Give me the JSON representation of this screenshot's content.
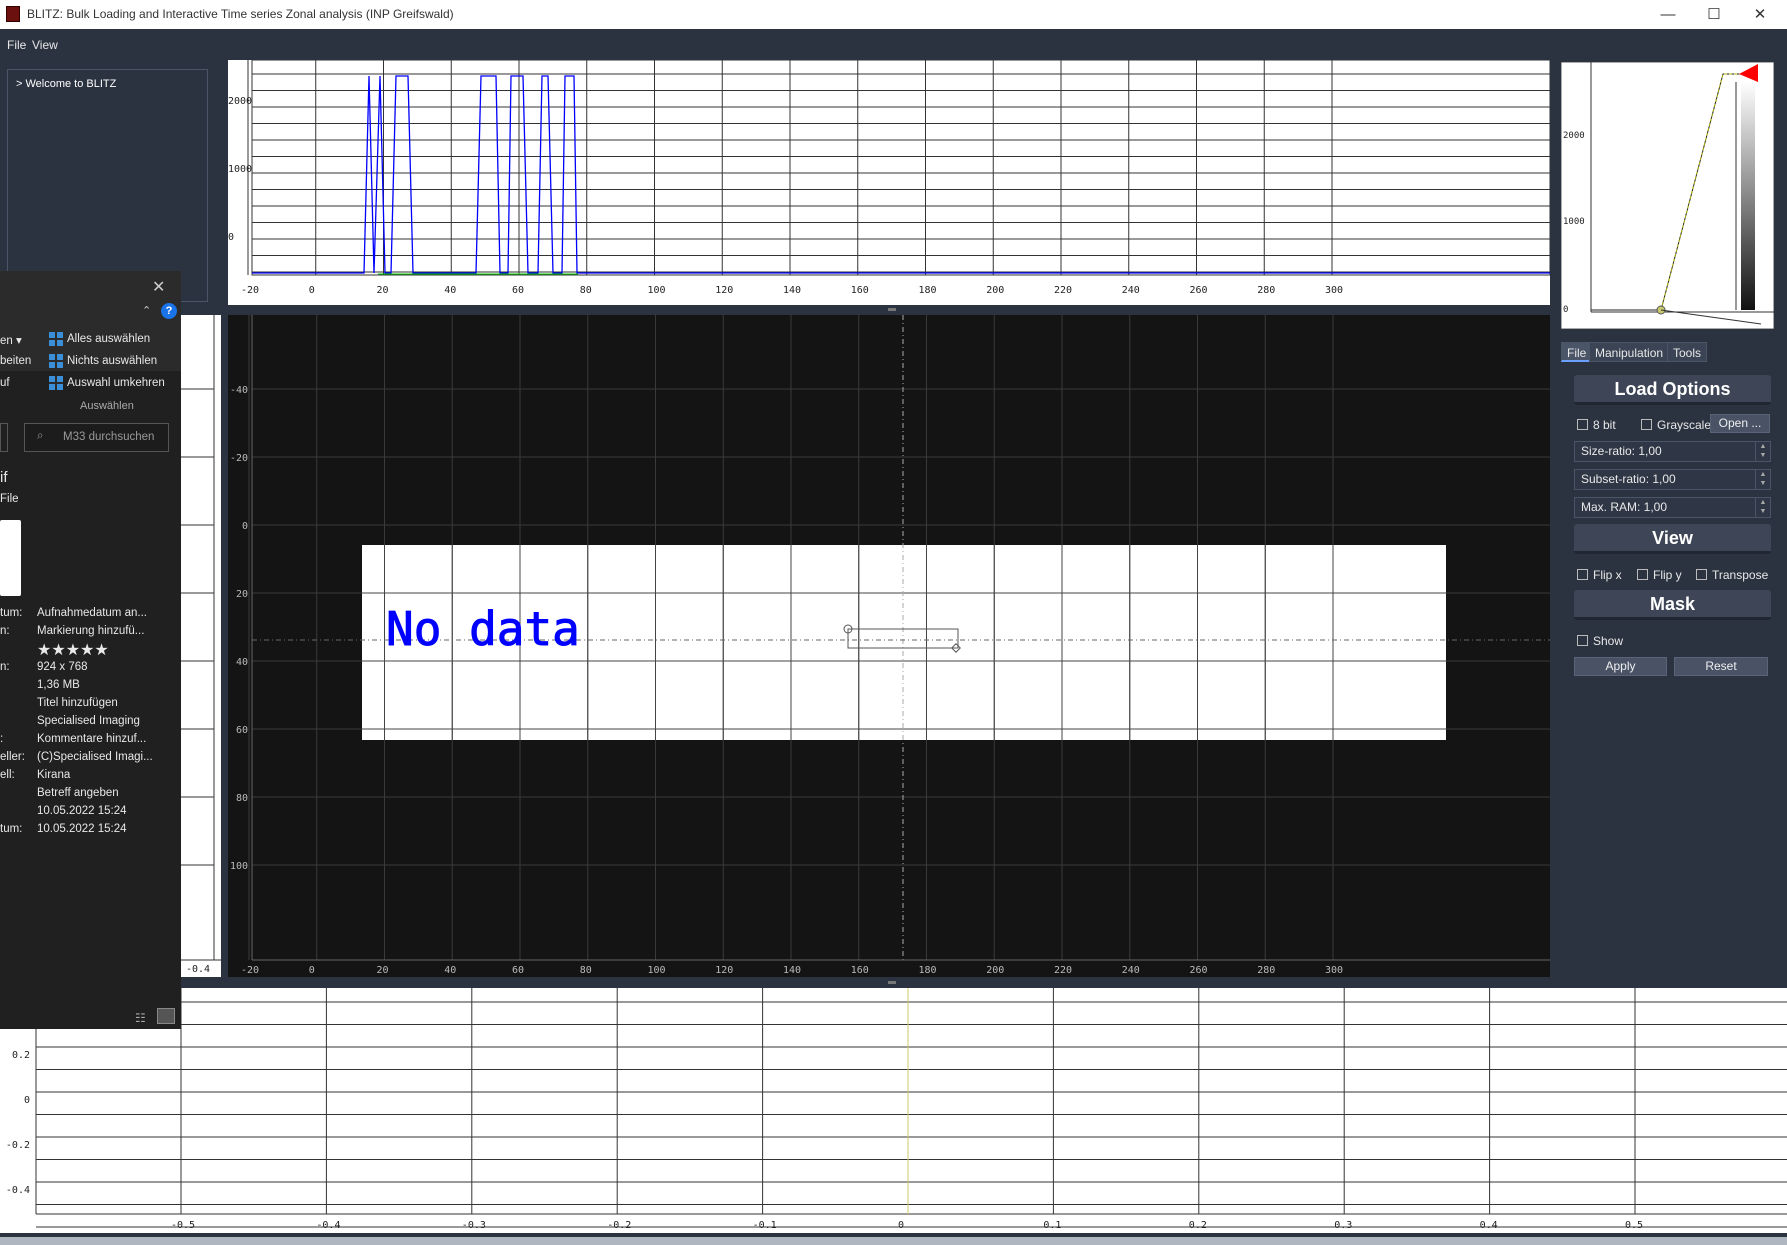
{
  "window": {
    "title": "BLITZ: Bulk Loading and Interactive Time series Zonal analysis (INP Greifswald)",
    "minimize": "—",
    "maximize": "☐",
    "close": "✕"
  },
  "menu": {
    "file": "File",
    "view": "View"
  },
  "log": {
    "text": "> Welcome to BLITZ"
  },
  "timeline_plot": {
    "x_ticks": [
      "-20",
      "0",
      "20",
      "40",
      "60",
      "80",
      "100",
      "120",
      "140",
      "160",
      "180",
      "200",
      "220",
      "240",
      "260",
      "280",
      "300"
    ],
    "y_ticks": [
      "2000",
      "1000",
      "0"
    ]
  },
  "main_image": {
    "no_data_text": "No data",
    "x_ticks": [
      "-20",
      "0",
      "20",
      "40",
      "60",
      "80",
      "100",
      "120",
      "140",
      "160",
      "180",
      "200",
      "220",
      "240",
      "260",
      "280",
      "300"
    ],
    "y_ticks": [
      "-40",
      "-20",
      "0",
      "20",
      "40",
      "60",
      "80",
      "100"
    ],
    "left_tick": "-0.4"
  },
  "histogram": {
    "y_ticks": [
      "2000",
      "1000",
      "0"
    ]
  },
  "bottom_plot": {
    "x_ticks": [
      "-0.5",
      "-0.4",
      "-0.3",
      "-0.2",
      "-0.1",
      "0",
      "0.1",
      "0.2",
      "0.3",
      "0.4",
      "0.5"
    ],
    "y_ticks": [
      "0.2",
      "0",
      "-0.2",
      "-0.4"
    ]
  },
  "explorer": {
    "menu_open": "en ▾",
    "menu_edit": "beiten",
    "menu_run": "uf",
    "select_all": "Alles auswählen",
    "select_none": "Nichts auswählen",
    "invert_selection": "Auswahl umkehren",
    "group_label": "Auswählen",
    "search_placeholder": "M33 durchsuchen",
    "file_ext": "if",
    "file_type": "File",
    "props": [
      {
        "k": "tum:",
        "v": "Aufnahmedatum an..."
      },
      {
        "k": "n:",
        "v": "Markierung hinzufü..."
      },
      {
        "k": "",
        "v": "★★★★★"
      },
      {
        "k": "n:",
        "v": "924 x 768"
      },
      {
        "k": "",
        "v": "1,36 MB"
      },
      {
        "k": "",
        "v": "Titel hinzufügen"
      },
      {
        "k": "",
        "v": "Specialised Imaging"
      },
      {
        "k": ":",
        "v": "Kommentare hinzuf..."
      },
      {
        "k": "eller:",
        "v": "(C)Specialised Imagi..."
      },
      {
        "k": "ell:",
        "v": "Kirana"
      },
      {
        "k": "",
        "v": "Betreff angeben"
      },
      {
        "k": "",
        "v": "10.05.2022 15:24"
      },
      {
        "k": "tum:",
        "v": "10.05.2022 15:24"
      }
    ]
  },
  "right_panel": {
    "tabs": [
      "File",
      "Manipulation",
      "Tools"
    ],
    "load_options": "Load Options",
    "cb_8bit": "8 bit",
    "cb_grayscale": "Grayscale",
    "open_button": "Open ...",
    "size_ratio": "Size-ratio: 1,00",
    "subset_ratio": "Subset-ratio: 1,00",
    "max_ram": "Max. RAM: 1,00",
    "view": "View",
    "flip_x": "Flip x",
    "flip_y": "Flip y",
    "transpose": "Transpose",
    "mask": "Mask",
    "show": "Show",
    "apply": "Apply",
    "reset": "Reset"
  },
  "colors": {
    "accent": "#6aa0ff",
    "plot_line": "#0000ff",
    "background": "#2b3341"
  }
}
